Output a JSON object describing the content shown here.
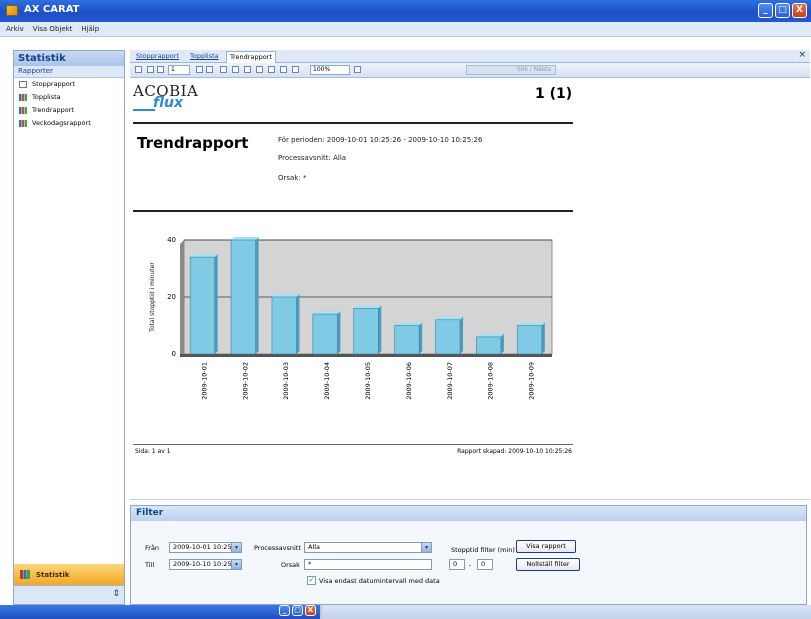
{
  "window": {
    "title": "AX CARAT",
    "min": "_",
    "max": "□",
    "close": "X"
  },
  "menu": [
    "Arkiv",
    "Visa Objekt",
    "Hjälp"
  ],
  "sidebar": {
    "header": "Statistik",
    "section": "Rapporter",
    "items": [
      {
        "label": "Stopprapport",
        "icon": "document-icon"
      },
      {
        "label": "Topplista",
        "icon": "bar-chart-icon"
      },
      {
        "label": "Trendrapport",
        "icon": "bar-chart-icon"
      },
      {
        "label": "Veckodagsrapport",
        "icon": "bar-chart-icon"
      }
    ],
    "module_button": "Statistik",
    "bottom_chevron": "⇕"
  },
  "tabs": [
    {
      "label": "Stopprapport",
      "active": false
    },
    {
      "label": "Topplista",
      "active": false
    },
    {
      "label": "Trendrapport",
      "active": true
    }
  ],
  "tab_close": "×",
  "toolbar": {
    "page_value": "1",
    "zoom_value": "100%",
    "search_placeholder": "Sök / Nästa"
  },
  "report": {
    "logo_top": "ACOBIA",
    "logo_bottom": "flux",
    "page_indicator": "1 (1)",
    "title": "Trendrapport",
    "period": "För perioden:  2009-10-01 10:25:26 - 2009-10-10 10:25:26",
    "process": "Processavsnitt: Alla",
    "cause": "Orsak: *",
    "footer_left": "Sida: 1 av 1",
    "footer_right": "Rapport skapad: 2009-10-10 10:25:26"
  },
  "chart_data": {
    "type": "bar",
    "categories": [
      "2009-10-01",
      "2009-10-02",
      "2009-10-03",
      "2009-10-04",
      "2009-10-05",
      "2009-10-06",
      "2009-10-07",
      "2009-10-08",
      "2009-10-09"
    ],
    "values": [
      34,
      40,
      20,
      14,
      16,
      10,
      12,
      6,
      10
    ],
    "ylabel": "Total stopptid i minuter",
    "ylim": [
      0,
      40
    ],
    "yticks": [
      0,
      20,
      40
    ],
    "bar_color": "#7fcbe6",
    "plot_background": "#d4d4d4",
    "grid": true
  },
  "filter": {
    "header": "Filter",
    "from_label": "Från",
    "from_value": "2009-10-01 10:25",
    "to_label": "Till",
    "to_value": "2009-10-10 10:25",
    "process_label": "Processavsnitt",
    "process_value": "Alla",
    "cause_label": "Orsak",
    "cause_value": "*",
    "stoptime_label": "Stopptid filter (min)",
    "stoptime_from": "0",
    "stoptime_dash": "-",
    "stoptime_to": "0",
    "show_button": "Visa rapport",
    "reset_button": "Nollställ filter",
    "checkbox_label": "Visa endast datumintervall med data",
    "checkbox_checked": true,
    "checkmark": "✓",
    "dropdown_arrow": "▾"
  }
}
